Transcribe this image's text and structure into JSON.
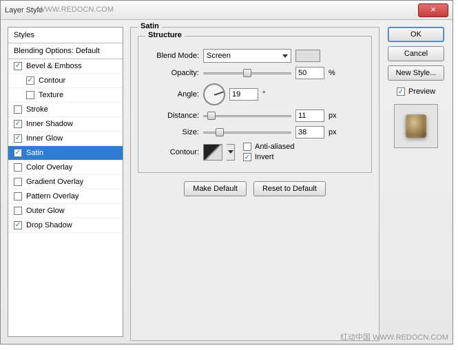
{
  "titlebar": {
    "title": "Layer Style",
    "watermark_top": "WWW.REDOCN.COM"
  },
  "close_label": "×",
  "styles": {
    "header": "Styles",
    "blending": "Blending Options: Default",
    "items": [
      {
        "label": "Bevel & Emboss",
        "checked": true,
        "indent": false
      },
      {
        "label": "Contour",
        "checked": true,
        "indent": true
      },
      {
        "label": "Texture",
        "checked": false,
        "indent": true
      },
      {
        "label": "Stroke",
        "checked": false,
        "indent": false
      },
      {
        "label": "Inner Shadow",
        "checked": true,
        "indent": false
      },
      {
        "label": "Inner Glow",
        "checked": true,
        "indent": false
      },
      {
        "label": "Satin",
        "checked": true,
        "indent": false,
        "selected": true
      },
      {
        "label": "Color Overlay",
        "checked": false,
        "indent": false
      },
      {
        "label": "Gradient Overlay",
        "checked": false,
        "indent": false
      },
      {
        "label": "Pattern Overlay",
        "checked": false,
        "indent": false
      },
      {
        "label": "Outer Glow",
        "checked": false,
        "indent": false
      },
      {
        "label": "Drop Shadow",
        "checked": true,
        "indent": false
      }
    ]
  },
  "panel": {
    "title": "Satin",
    "structure": "Structure",
    "blend_mode_lbl": "Blend Mode:",
    "blend_mode_val": "Screen",
    "opacity_lbl": "Opacity:",
    "opacity_val": "50",
    "opacity_unit": "%",
    "angle_lbl": "Angle:",
    "angle_val": "19",
    "angle_unit": "°",
    "distance_lbl": "Distance:",
    "distance_val": "11",
    "distance_unit": "px",
    "size_lbl": "Size:",
    "size_val": "38",
    "size_unit": "px",
    "contour_lbl": "Contour:",
    "aa_lbl": "Anti-aliased",
    "aa_checked": false,
    "invert_lbl": "Invert",
    "invert_checked": true,
    "make_default": "Make Default",
    "reset_default": "Reset to Default"
  },
  "buttons": {
    "ok": "OK",
    "cancel": "Cancel",
    "new_style": "New Style...",
    "preview": "Preview"
  },
  "watermark_bottom": "红动中国  WWW.REDOCN.COM"
}
